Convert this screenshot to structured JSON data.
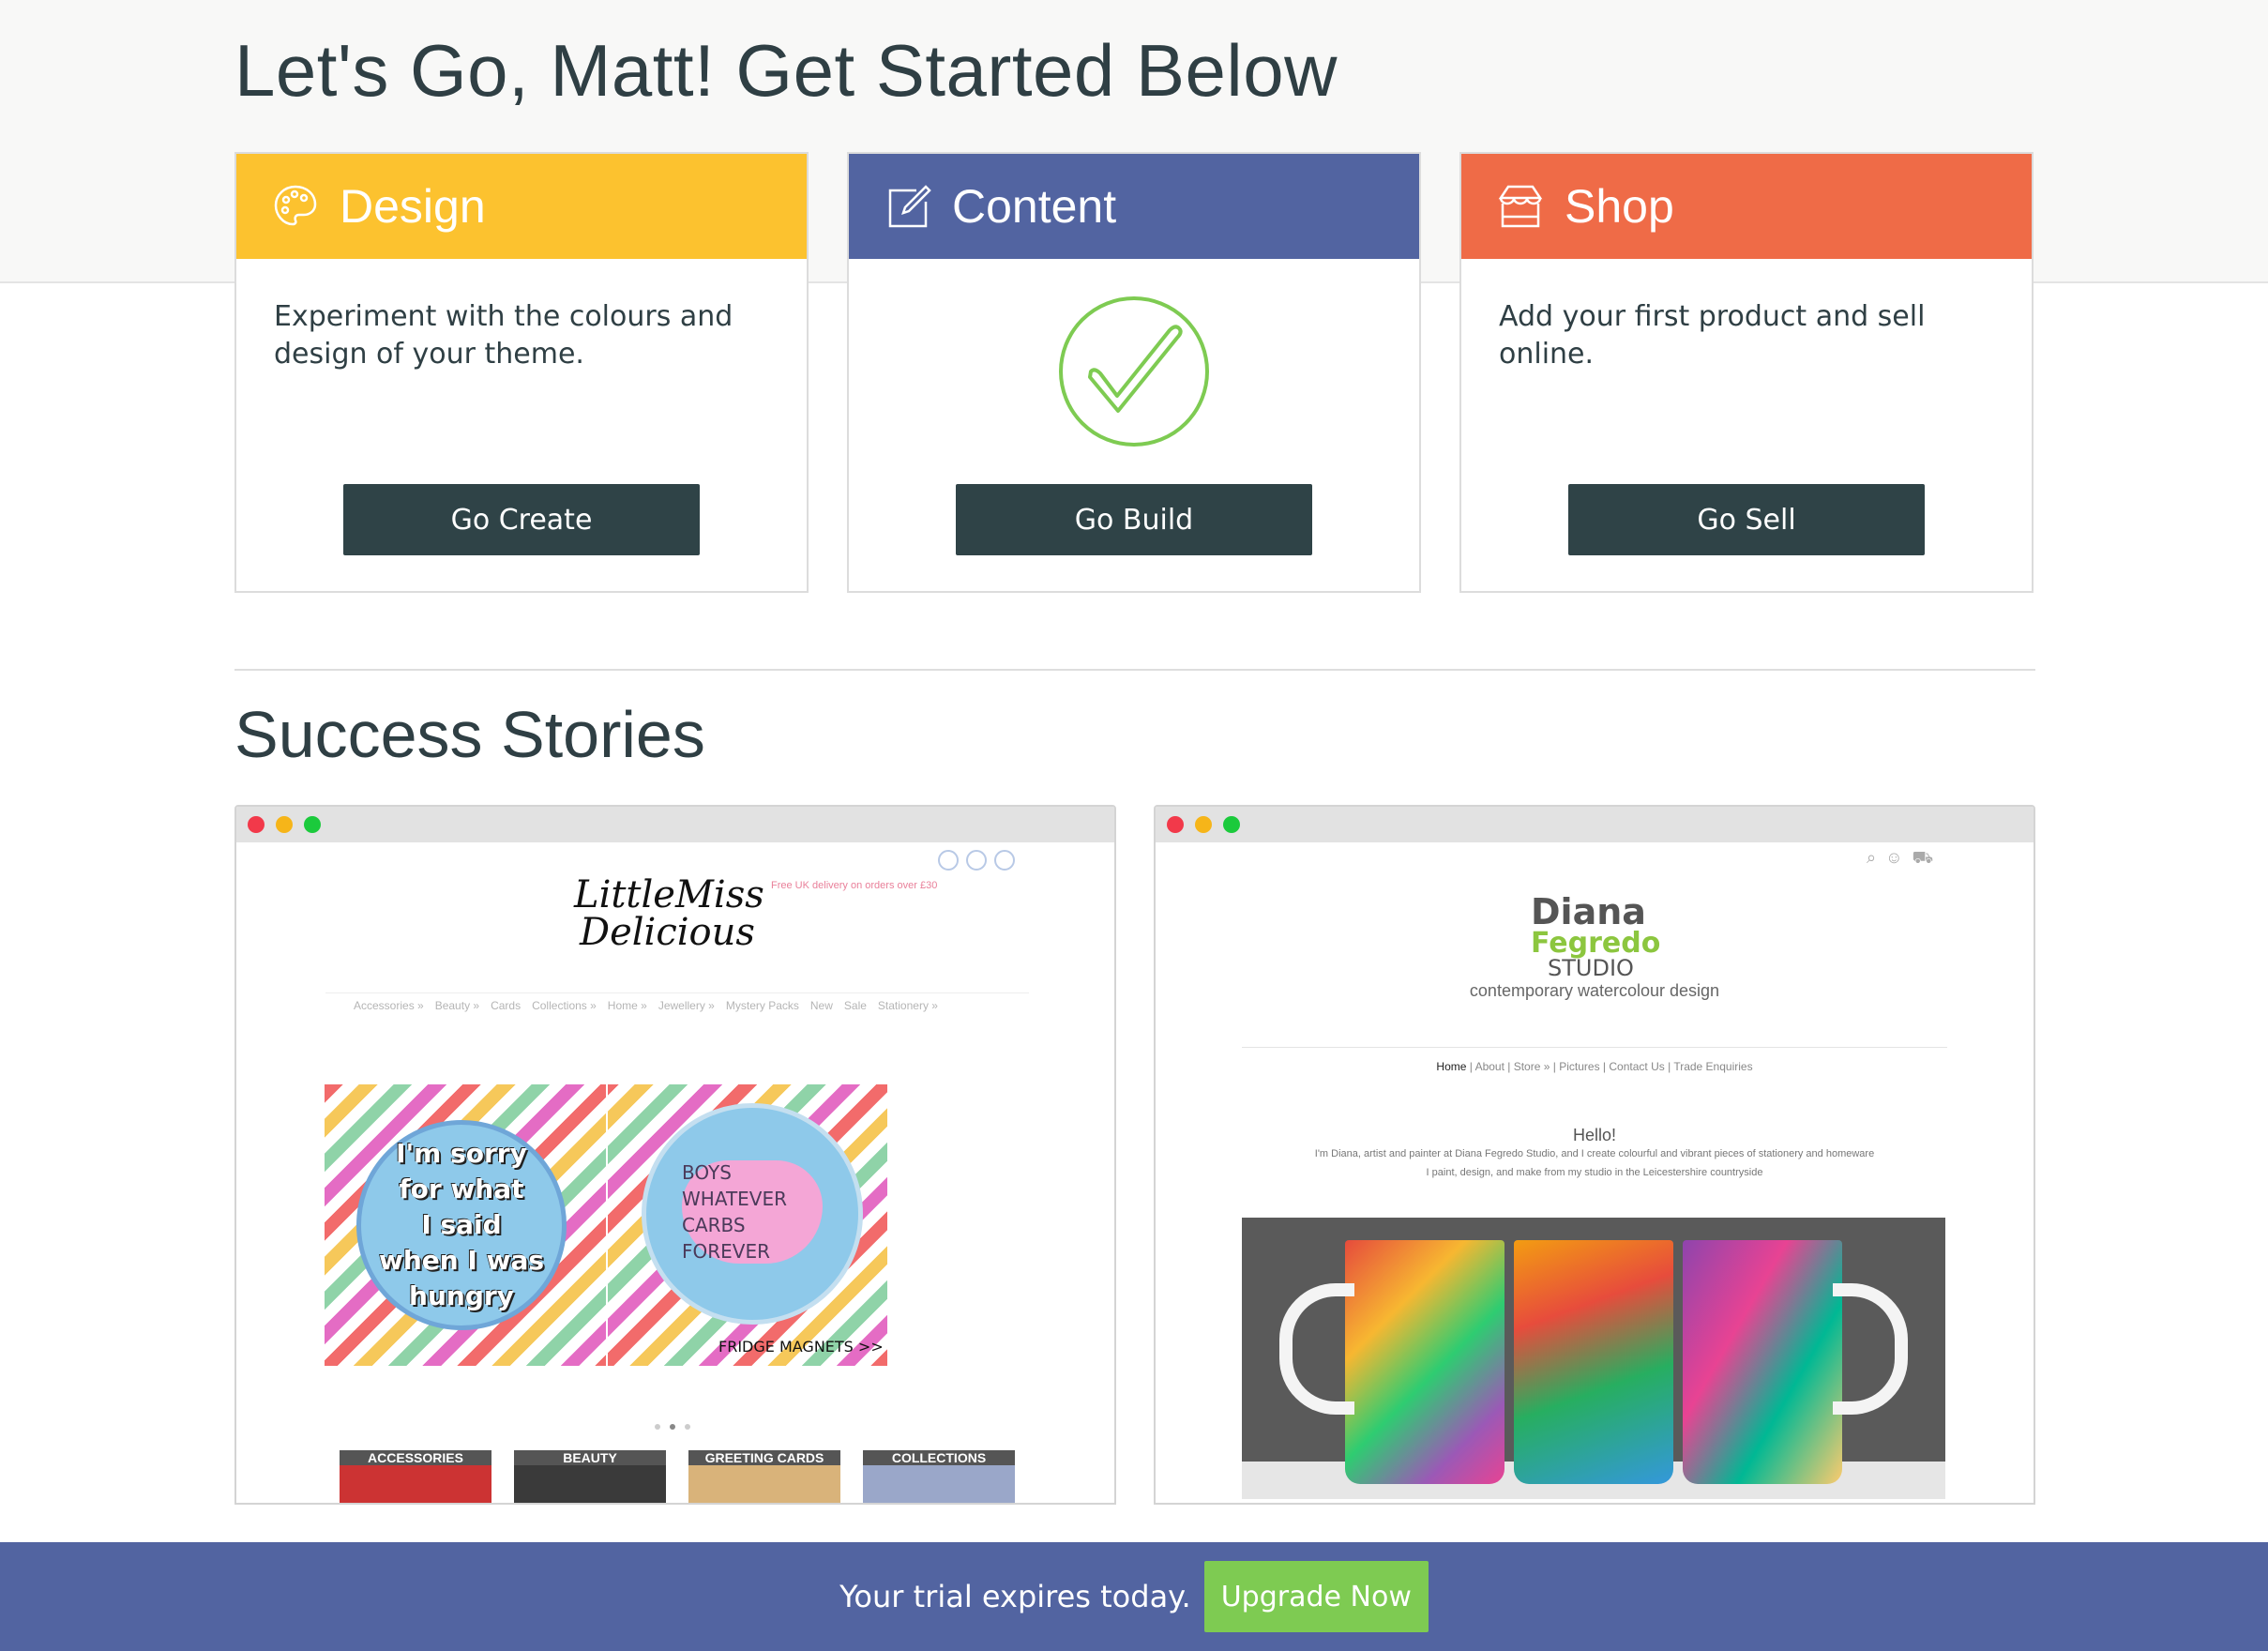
{
  "page": {
    "title": "Let's Go, Matt! Get Started Below",
    "success_title": "Success Stories"
  },
  "cards": [
    {
      "key": "design",
      "title": "Design",
      "icon": "palette-icon",
      "color": "#fcc22f",
      "description": "Experiment with the colours and design of your theme.",
      "button": "Go Create"
    },
    {
      "key": "content",
      "title": "Content",
      "icon": "edit-icon",
      "color": "#5264a1",
      "completed": true,
      "button": "Go Build"
    },
    {
      "key": "shop",
      "title": "Shop",
      "icon": "store-icon",
      "color": "#ef6b47",
      "description": "Add your first product and sell online.",
      "button": "Go Sell"
    }
  ],
  "stories": [
    {
      "name": "Little Miss Delicious",
      "logo_line1": "LittleMiss",
      "logo_line2": "Delicious",
      "promo": "Free UK delivery on orders over £30",
      "nav": [
        "Accessories »",
        "Beauty »",
        "Cards",
        "Collections »",
        "Home »",
        "Jewellery »",
        "Mystery Packs",
        "New",
        "Sale",
        "Stationery »"
      ],
      "badge1": [
        "I'm sorry",
        "for what",
        "I said",
        "when I was",
        "hungry"
      ],
      "badge2": [
        "BOYS WHATEVER",
        "CARBS FOREVER"
      ],
      "slide_caption": "FRIDGE MAGNETS >>",
      "categories": [
        "ACCESSORIES",
        "BEAUTY",
        "GREETING CARDS",
        "COLLECTIONS"
      ]
    },
    {
      "name": "Diana Fegredo Studio",
      "logo_line1": "Diana",
      "logo_line2": "Fegredo",
      "logo_line3": "STUDIO",
      "tagline": "contemporary watercolour design",
      "nav": [
        "Home",
        "About",
        "Store »",
        "Pictures",
        "Contact Us",
        "Trade Enquiries"
      ],
      "hello": "Hello!",
      "intro1": "I'm Diana, artist and painter at Diana Fegredo Studio, and I create colourful and vibrant pieces of stationery and homeware",
      "intro2": "I paint, design, and make from my studio in the Leicestershire countryside"
    }
  ],
  "banner": {
    "text": "Your trial expires today.",
    "button": "Upgrade Now",
    "color": "#5264a1",
    "button_color": "#7ecb52"
  }
}
